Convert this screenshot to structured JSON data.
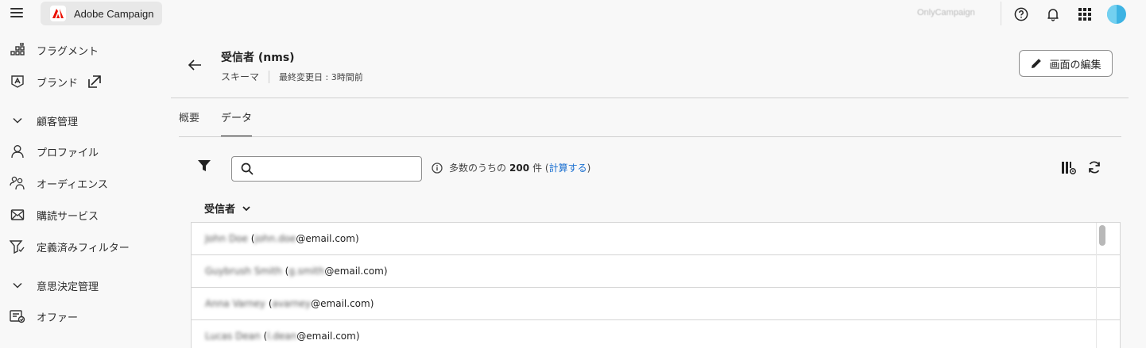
{
  "app": {
    "name": "Adobe Campaign",
    "org": "OnlyCampaign"
  },
  "topbar_icons": [
    "menu-icon",
    "help-icon",
    "bell-icon",
    "apps-grid-icon"
  ],
  "sidebar": {
    "items": [
      {
        "label": "フラグメント",
        "icon": "fragment-icon"
      },
      {
        "label": "ブランド",
        "icon": "brand-icon"
      },
      {
        "label": "顧客管理",
        "icon": "chevron-down-icon",
        "section": true
      },
      {
        "label": "プロファイル",
        "icon": "user-icon"
      },
      {
        "label": "オーディエンス",
        "icon": "audience-icon"
      },
      {
        "label": "購読サービス",
        "icon": "subscription-icon"
      },
      {
        "label": "定義済みフィルター",
        "icon": "filter-funnel-icon"
      },
      {
        "label": "意思決定管理",
        "icon": "chevron-down-icon",
        "section": true
      },
      {
        "label": "オファー",
        "icon": "offer-icon"
      }
    ]
  },
  "header": {
    "title": "受信者 (nms)",
    "type": "スキーマ",
    "modified": "最終変更日 : 3時間前",
    "edit_button": "画面の編集"
  },
  "tabs": [
    {
      "label": "概要",
      "active": false
    },
    {
      "label": "データ",
      "active": true
    }
  ],
  "toolbar": {
    "search_placeholder": "",
    "count_prefix": "多数のうちの",
    "count_value": "200",
    "count_suffix": "件 (",
    "count_link": "計算する",
    "count_close": ")"
  },
  "table": {
    "column": "受信者",
    "rows": [
      {
        "name": "John Doe",
        "local": "john.doe",
        "domain": "@email.com)"
      },
      {
        "name": "Guybrush Smith",
        "local": "g.smith",
        "domain": "@email.com)"
      },
      {
        "name": "Anna Varney",
        "local": "avarney",
        "domain": "@email.com)"
      },
      {
        "name": "Lucas Dean",
        "local": "l.dean",
        "domain": "@email.com)"
      }
    ]
  },
  "colors": {
    "accent_link": "#1a6fd0",
    "avatar": "#3db3e3",
    "logo_red": "#eb1000"
  }
}
